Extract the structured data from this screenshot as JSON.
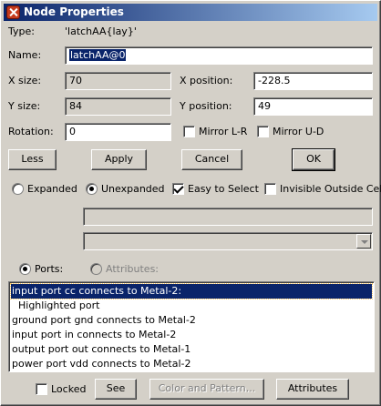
{
  "window": {
    "title": "Node Properties"
  },
  "type_row": {
    "label": "Type:",
    "value": "'latchAA{lay}'"
  },
  "name_row": {
    "label": "Name:",
    "value": "latchAA@0"
  },
  "x_size": {
    "label": "X size:",
    "value": "70"
  },
  "y_size": {
    "label": "Y size:",
    "value": "84"
  },
  "x_position": {
    "label": "X position:",
    "value": "-228.5"
  },
  "y_position": {
    "label": "Y position:",
    "value": "49"
  },
  "rotation": {
    "label": "Rotation:",
    "value": "0"
  },
  "mirror_lr": {
    "label": "Mirror L-R",
    "checked": false
  },
  "mirror_ud": {
    "label": "Mirror U-D",
    "checked": false
  },
  "buttons": {
    "less": "Less",
    "apply": "Apply",
    "cancel": "Cancel",
    "ok": "OK"
  },
  "expansion": {
    "expanded": "Expanded",
    "unexpanded": "Unexpanded",
    "selected": "unexpanded"
  },
  "easy_to_select": {
    "label": "Easy to Select",
    "checked": true
  },
  "invisible_outside": {
    "label": "Invisible Outside Cell",
    "checked": false
  },
  "extra_field": {
    "value": ""
  },
  "extra_dropdown": {
    "value": ""
  },
  "view_mode": {
    "ports": "Ports:",
    "attributes": "Attributes:",
    "selected": "ports"
  },
  "ports_list": [
    "input port cc connects to Metal-2:",
    "  Highlighted port",
    "ground port gnd connects to Metal-2",
    "input port in connects to Metal-2",
    "output port out connects to Metal-1",
    "power port vdd connects to Metal-2"
  ],
  "ports_list_selected_index": 0,
  "bottom": {
    "locked": "Locked",
    "see": "See",
    "color_pattern": "Color and Pattern...",
    "attributes": "Attributes"
  }
}
